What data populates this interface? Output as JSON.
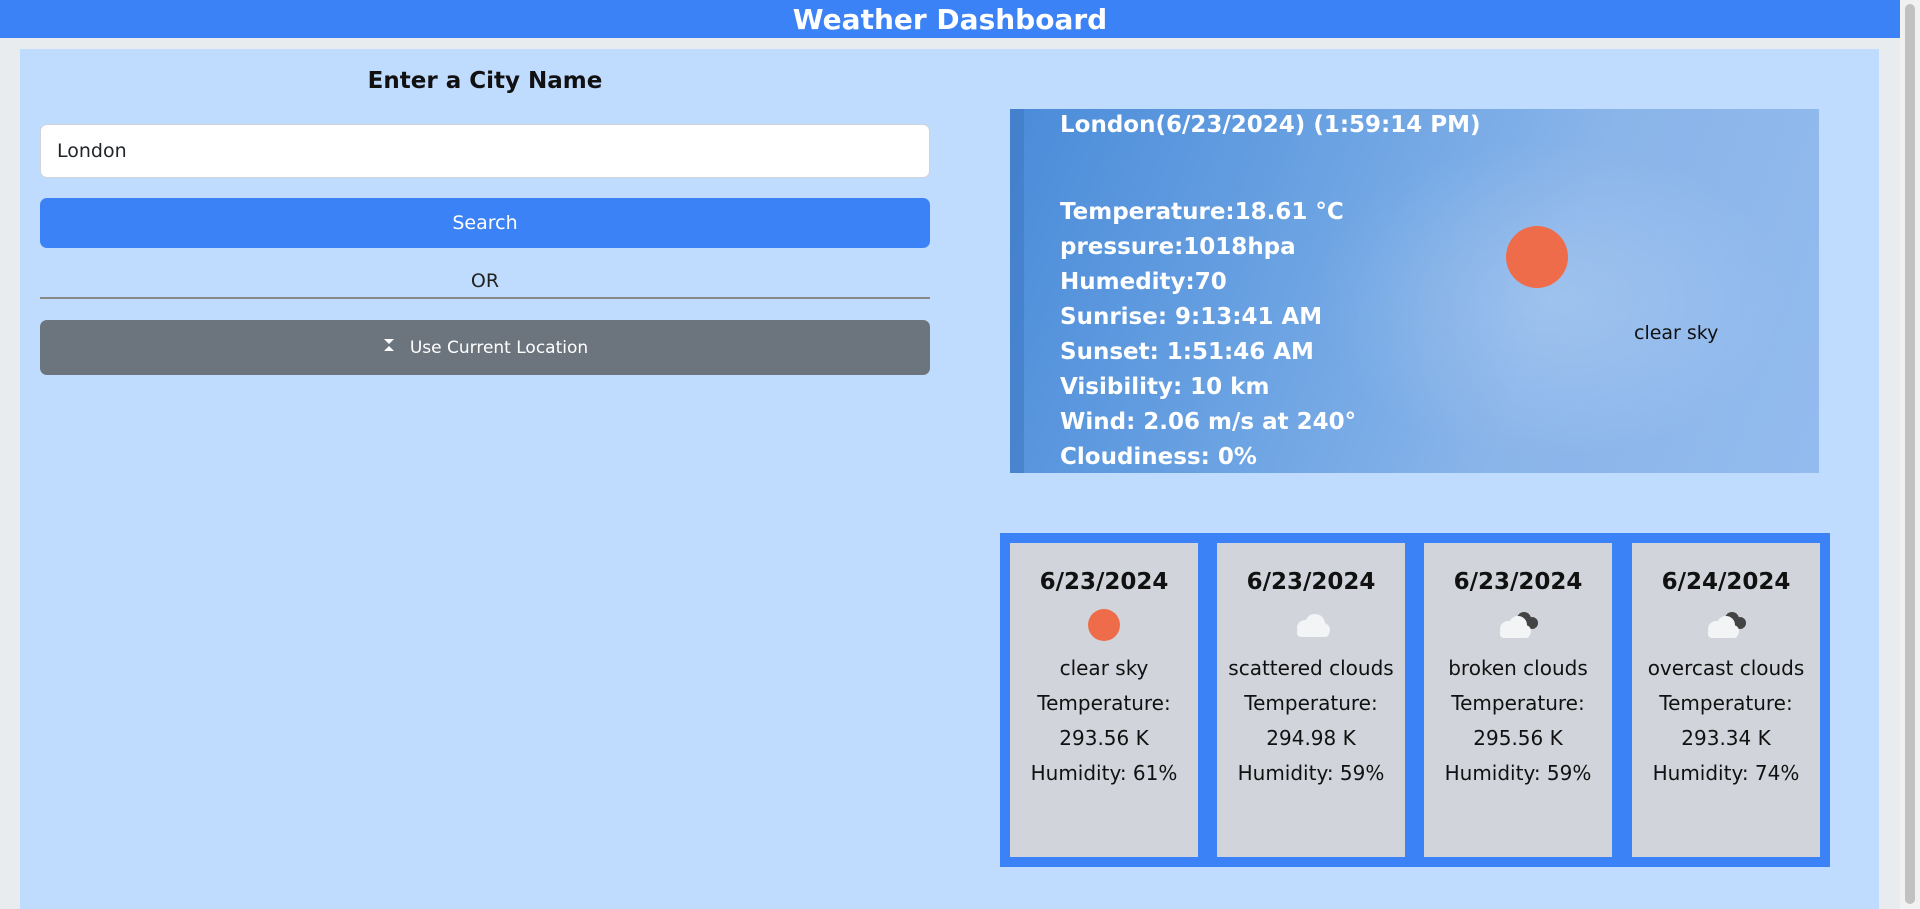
{
  "header": {
    "title": "Weather Dashboard"
  },
  "search": {
    "heading": "Enter a City Name",
    "city_value": "London",
    "search_label": "Search",
    "or_label": "OR",
    "location_label": "Use Current Location",
    "location_icon": "location-icon"
  },
  "current": {
    "title": "London(6/23/2024) (1:59:14 PM)",
    "temperature": "Temperature:18.61 °C",
    "pressure": "pressure:1018hpa",
    "humidity": "Humedity:70",
    "sunrise": "Sunrise: 9:13:41 AM",
    "sunset": "Sunset: 1:51:46 AM",
    "visibility": "Visibility: 10 km",
    "wind": "Wind: 2.06 m/s at 240°",
    "cloudiness": "Cloudiness: 0%",
    "description": "clear sky",
    "icon": "sun-icon"
  },
  "forecast": [
    {
      "date": "6/23/2024",
      "icon": "sun-icon",
      "desc": "clear sky",
      "temp_label": "Temperature:",
      "temp": "293.56 K",
      "humidity": "Humidity: 61%"
    },
    {
      "date": "6/23/2024",
      "icon": "cloud-icon",
      "desc": "scattered clouds",
      "temp_label": "Temperature:",
      "temp": "294.98 K",
      "humidity": "Humidity: 59%"
    },
    {
      "date": "6/23/2024",
      "icon": "broken-clouds-icon",
      "desc": "broken clouds",
      "temp_label": "Temperature:",
      "temp": "295.56 K",
      "humidity": "Humidity: 59%"
    },
    {
      "date": "6/24/2024",
      "icon": "overcast-clouds-icon",
      "desc": "overcast clouds",
      "temp_label": "Temperature:",
      "temp": "293.34 K",
      "humidity": "Humidity: 74%"
    }
  ],
  "colors": {
    "accent": "#3b82f6",
    "panel_bg": "#bfdbfe",
    "secondary_button": "#6c757d",
    "sun": "#ef6c4a",
    "forecast_card": "#d1d5db"
  }
}
